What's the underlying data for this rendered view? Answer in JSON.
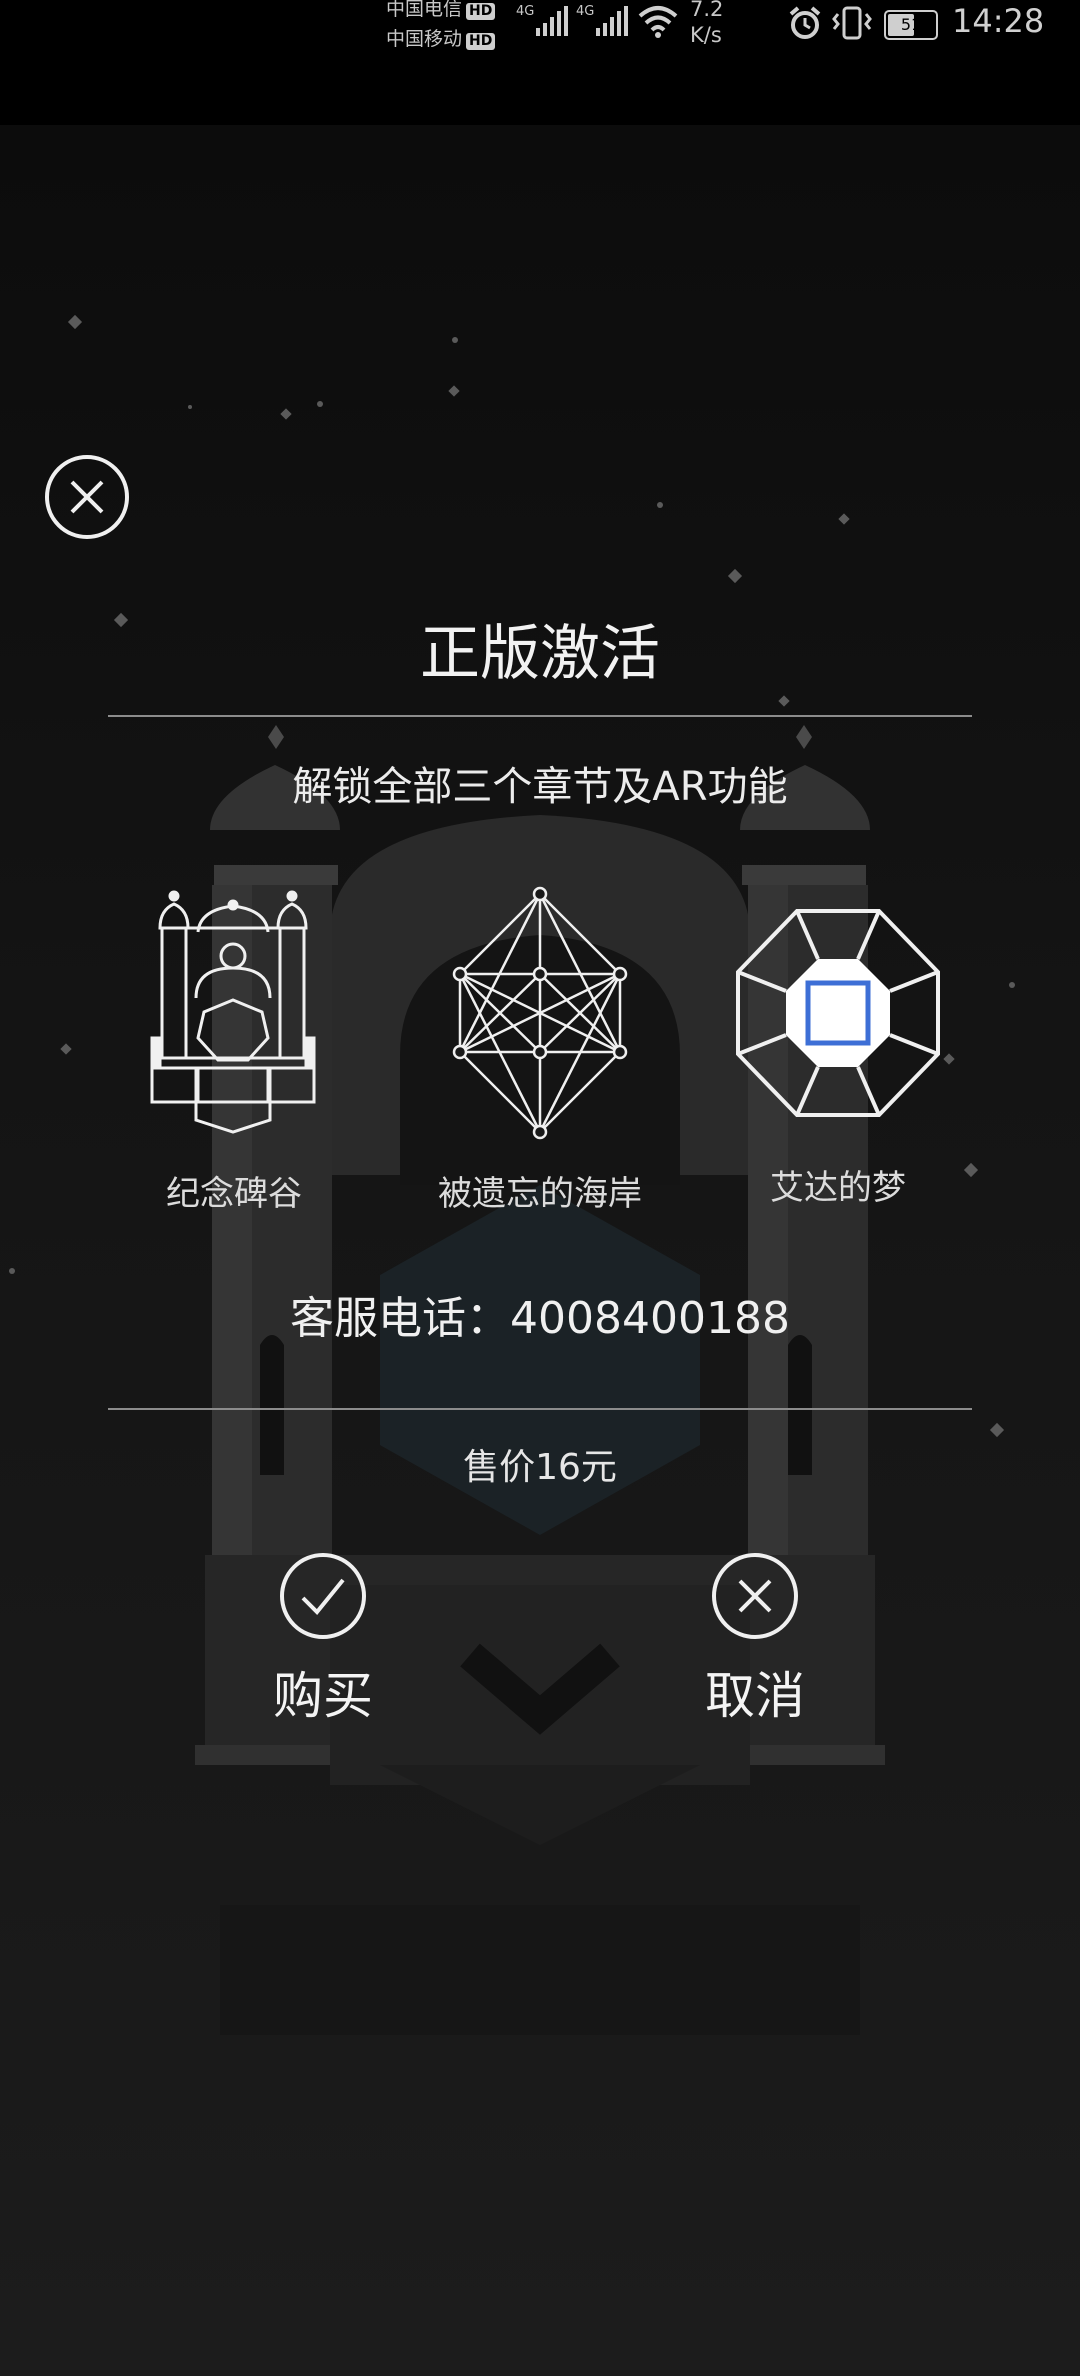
{
  "status_bar": {
    "carrier1": "中国电信",
    "carrier2": "中国移动",
    "hd_badge": "HD",
    "network1": "4G",
    "network2": "4G",
    "speed_value": "7.2",
    "speed_unit": "K/s",
    "battery": "51",
    "time": "14:28"
  },
  "dialog": {
    "title": "正版激活",
    "subtitle": "解锁全部三个章节及AR功能",
    "chapters": [
      {
        "label": "纪念碑谷",
        "icon": "monument-icon"
      },
      {
        "label": "被遗忘的海岸",
        "icon": "forgotten-shores-icon"
      },
      {
        "label": "艾达的梦",
        "icon": "idas-dream-icon"
      }
    ],
    "hotline": "客服电话：4008400188",
    "price": "售价16元",
    "buy_label": "购买",
    "cancel_label": "取消"
  },
  "colors": {
    "background": "#101010",
    "accent_blue": "#3d6fd6",
    "text": "#ececec"
  }
}
